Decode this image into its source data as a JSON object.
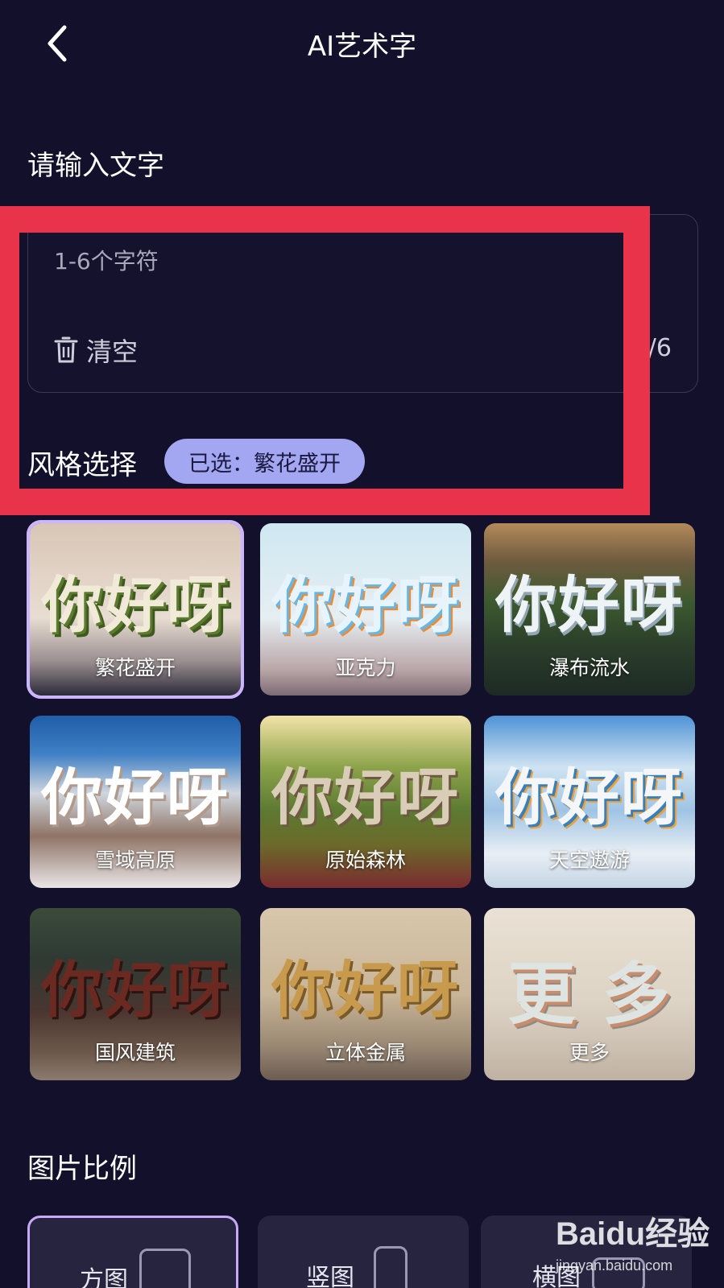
{
  "header": {
    "title": "AI艺术字"
  },
  "input_section": {
    "label": "请输入文字",
    "placeholder": "1-6个字符",
    "clear_label": "清空",
    "counter": "0/6"
  },
  "style_section": {
    "label": "风格选择",
    "selected_chip": "已选：繁花盛开",
    "sample_text": "你好呀",
    "cards": [
      {
        "label": "繁花盛开",
        "selected": true
      },
      {
        "label": "亚克力",
        "selected": false
      },
      {
        "label": "瀑布流水",
        "selected": false
      },
      {
        "label": "雪域高原",
        "selected": false
      },
      {
        "label": "原始森林",
        "selected": false
      },
      {
        "label": "天空遨游",
        "selected": false
      },
      {
        "label": "国风建筑",
        "selected": false
      },
      {
        "label": "立体金属",
        "selected": false
      },
      {
        "label": "更多",
        "selected": false,
        "art_text": "更 多"
      }
    ]
  },
  "ratio_section": {
    "label": "图片比例",
    "options": [
      {
        "label": "方图",
        "selected": true
      },
      {
        "label": "竖图",
        "selected": false
      },
      {
        "label": "横图",
        "selected": false
      }
    ]
  },
  "watermark": {
    "logo": "Baidu经验",
    "url": "jingyan.baidu.com"
  },
  "colors": {
    "background": "#12102a",
    "chip": "#a3a6f0",
    "highlight": "#e8334a",
    "selected_outline": "#c7b5ff"
  }
}
